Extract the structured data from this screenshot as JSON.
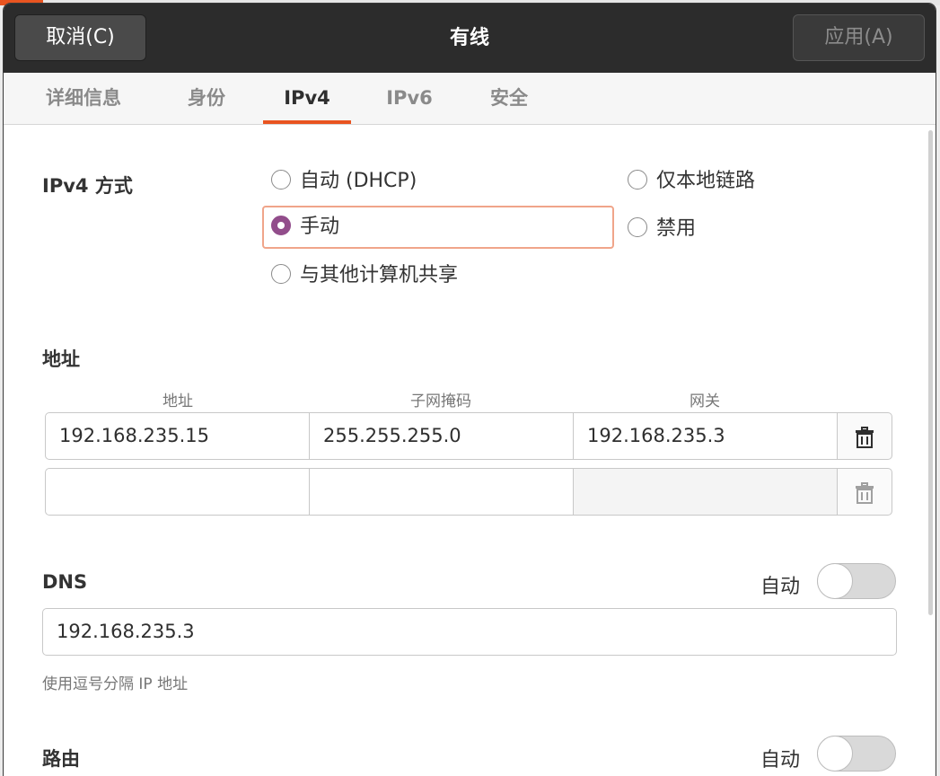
{
  "dialog": {
    "title": "有线",
    "cancel_label": "取消(C)",
    "apply_label": "应用(A)"
  },
  "tabs": [
    {
      "label": "详细信息",
      "active": false
    },
    {
      "label": "身份",
      "active": false
    },
    {
      "label": "IPv4",
      "active": true
    },
    {
      "label": "IPv6",
      "active": false
    },
    {
      "label": "安全",
      "active": false
    }
  ],
  "ipv4_method": {
    "label": "IPv4 方式",
    "options": [
      {
        "label": "自动 (DHCP)",
        "checked": false
      },
      {
        "label": "仅本地链路",
        "checked": false
      },
      {
        "label": "手动",
        "checked": true
      },
      {
        "label": "禁用",
        "checked": false
      },
      {
        "label": "与其他计算机共享",
        "checked": false
      }
    ]
  },
  "addresses": {
    "label": "地址",
    "columns": [
      "地址",
      "子网掩码",
      "网关"
    ],
    "rows": [
      {
        "address": "192.168.235.15",
        "netmask": "255.255.255.0",
        "gateway": "192.168.235.3"
      },
      {
        "address": "",
        "netmask": "",
        "gateway": ""
      }
    ],
    "delete_icon": "trash-icon"
  },
  "dns": {
    "label": "DNS",
    "auto_label": "自动",
    "auto_enabled": false,
    "value": "192.168.235.3",
    "hint": "使用逗号分隔 IP 地址"
  },
  "routes": {
    "label": "路由",
    "auto_label": "自动",
    "auto_enabled": false
  },
  "colors": {
    "accent": "#e95420",
    "radio_checked": "#924d8b",
    "header_bg": "#2c2c2c"
  }
}
